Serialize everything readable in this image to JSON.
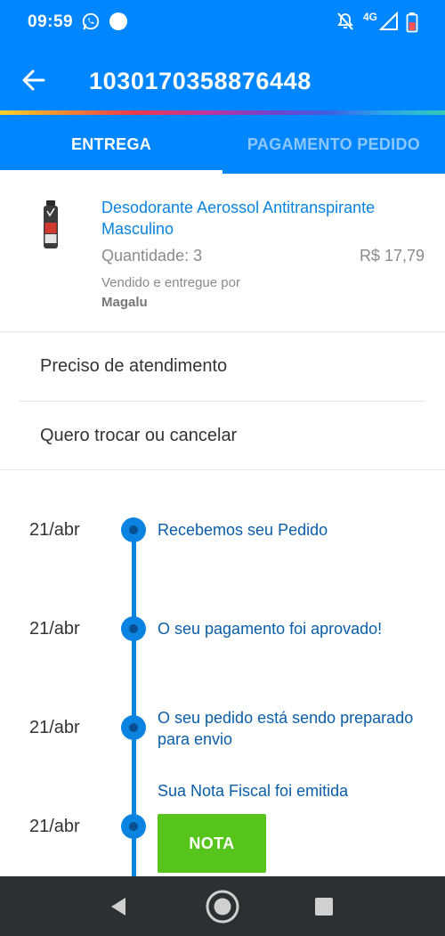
{
  "status_bar": {
    "time": "09:59",
    "network": "4G",
    "icons": [
      "whatsapp-icon",
      "notification-dot-icon",
      "bell-off-icon",
      "signal-icon",
      "battery-icon"
    ]
  },
  "app_bar": {
    "title": "1030170358876448",
    "back_icon": "arrow-back-icon"
  },
  "tabs": [
    {
      "label": "ENTREGA",
      "active": true
    },
    {
      "label": "PAGAMENTO PEDIDO",
      "active": false
    }
  ],
  "product": {
    "name": "Desodorante Aerossol Antitranspirante Masculino",
    "quantity": "Quantidade: 3",
    "price": "R$ 17,79",
    "sold_by": "Vendido e entregue por",
    "seller": "Magalu"
  },
  "menu": {
    "help": "Preciso de atendimento",
    "exchange": "Quero trocar ou cancelar"
  },
  "timeline": [
    {
      "date": "21/abr",
      "text": "Recebemos seu Pedido"
    },
    {
      "date": "21/abr",
      "text": "O seu pagamento foi aprovado!"
    },
    {
      "date": "21/abr",
      "text": "O seu pedido está sendo preparado para envio"
    },
    {
      "date": "21/abr",
      "text": "Sua Nota Fiscal foi emitida"
    }
  ],
  "nota_button": "NOTA",
  "colors": {
    "primary": "#0086ff",
    "link": "#0a84e0",
    "success": "#57c41c",
    "nav": "#2d2f32"
  }
}
